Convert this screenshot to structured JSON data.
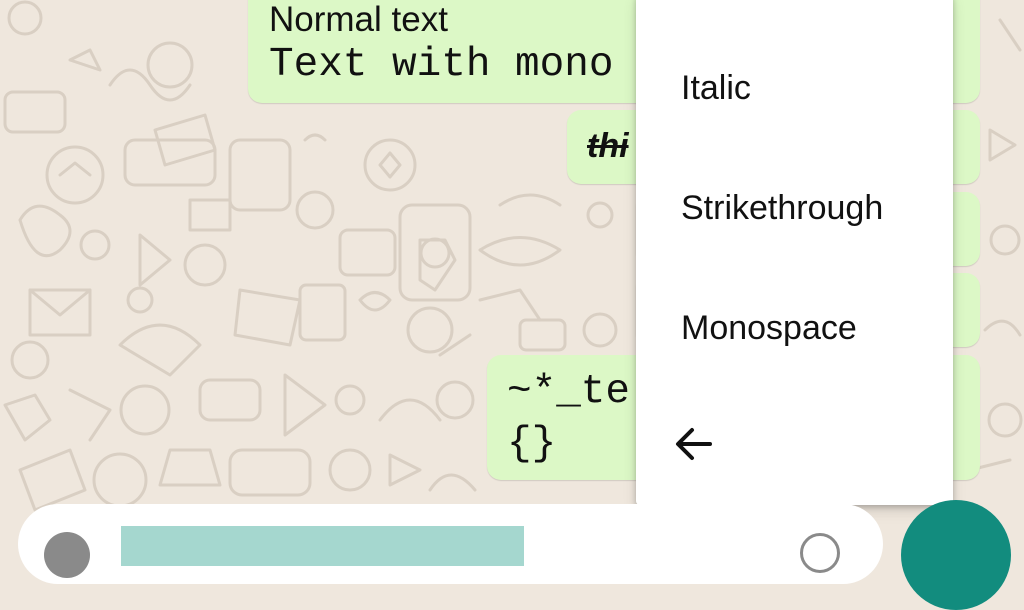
{
  "colors": {
    "wallpaper": "#efe7dd",
    "outgoing_bubble": "#dcf8c6",
    "menu_background": "#ffffff",
    "selection_highlight": "#a5d7cf",
    "send_button": "#128c7e"
  },
  "messages": [
    {
      "line1": "Normal text",
      "line2": "Text with mono"
    },
    {
      "text": "thi"
    },
    {
      "text": ""
    },
    {
      "text": ""
    },
    {
      "line1": "~*_te",
      "line2": "{}"
    }
  ],
  "format_menu": {
    "items": [
      "Italic",
      "Strikethrough",
      "Monospace"
    ],
    "back_icon": "arrow-back-icon"
  },
  "composer": {
    "emoji_icon": "emoji-icon",
    "attach_icon": "attach-icon",
    "send_icon": "send-icon"
  }
}
